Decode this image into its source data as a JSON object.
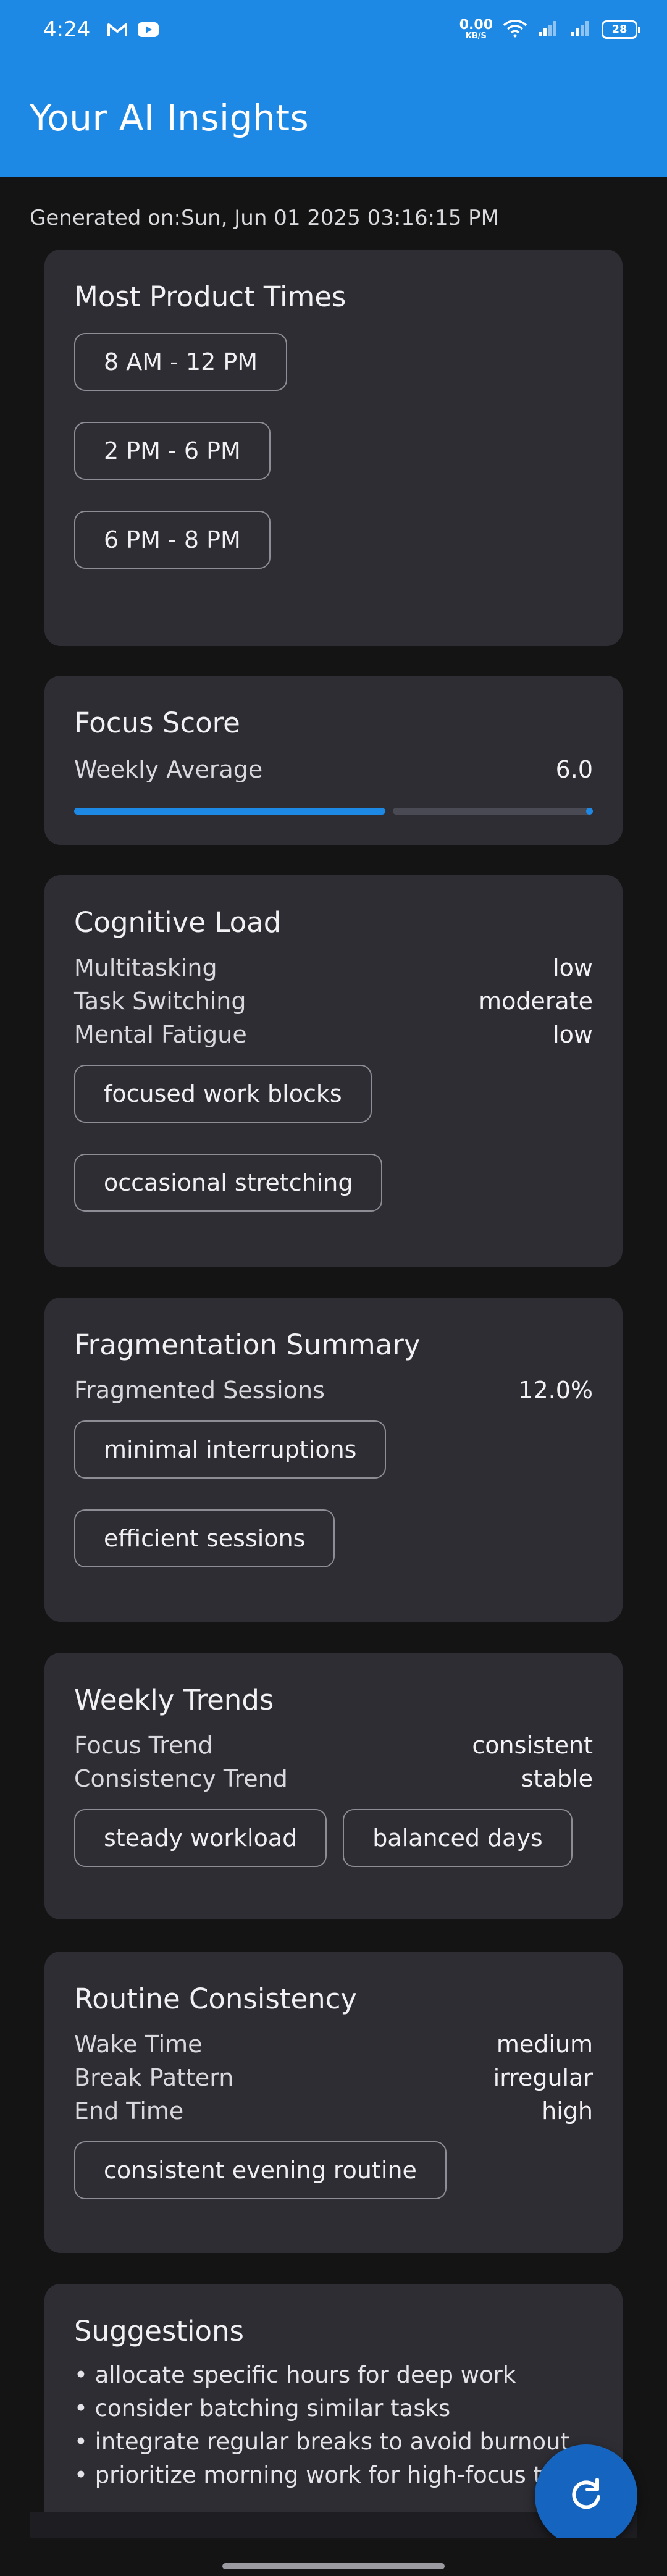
{
  "status_bar": {
    "time": "4:24",
    "net_speed_value": "0.00",
    "net_speed_unit": "KB/S",
    "battery": "28",
    "icons": [
      "gmail-icon",
      "youtube-icon",
      "wifi-icon",
      "signal-icon",
      "signal-icon",
      "battery-icon"
    ]
  },
  "app_bar": {
    "title": "Your AI Insights"
  },
  "generated": {
    "text": "Generated on:Sun, Jun 01 2025 03:16:15 PM"
  },
  "productive_times": {
    "title": "Most Product Times",
    "slots": [
      "8 AM - 12 PM",
      "2 PM - 6 PM",
      "6 PM - 8 PM"
    ]
  },
  "focus_score": {
    "title": "Focus Score",
    "label": "Weekly Average",
    "value": "6.0",
    "progress_fraction": 0.6
  },
  "cognitive_load": {
    "title": "Cognitive Load",
    "rows": [
      {
        "label": "Multitasking",
        "value": "low"
      },
      {
        "label": "Task Switching",
        "value": "moderate"
      },
      {
        "label": "Mental Fatigue",
        "value": "low"
      }
    ],
    "tags": [
      "focused work blocks",
      "occasional stretching"
    ]
  },
  "fragmentation": {
    "title": "Fragmentation Summary",
    "label": "Fragmented Sessions",
    "value": "12.0%",
    "tags": [
      "minimal interruptions",
      "efficient sessions"
    ]
  },
  "weekly_trends": {
    "title": "Weekly Trends",
    "rows": [
      {
        "label": "Focus Trend",
        "value": "consistent"
      },
      {
        "label": "Consistency Trend",
        "value": "stable"
      }
    ],
    "tags": [
      "steady workload",
      "balanced days"
    ]
  },
  "routine": {
    "title": "Routine Consistency",
    "rows": [
      {
        "label": "Wake Time",
        "value": "medium"
      },
      {
        "label": "Break Pattern",
        "value": "irregular"
      },
      {
        "label": "End Time",
        "value": "high"
      }
    ],
    "tags": [
      "consistent evening routine"
    ]
  },
  "suggestions": {
    "title": "Suggestions",
    "items": [
      "• allocate specific hours for deep work",
      "• consider batching similar tasks",
      "• integrate regular breaks to avoid burnout",
      "• prioritize morning work for high-focus tasks"
    ]
  },
  "colors": {
    "accent": "#1e88e5",
    "card": "#2e2d33",
    "background": "#141414"
  }
}
